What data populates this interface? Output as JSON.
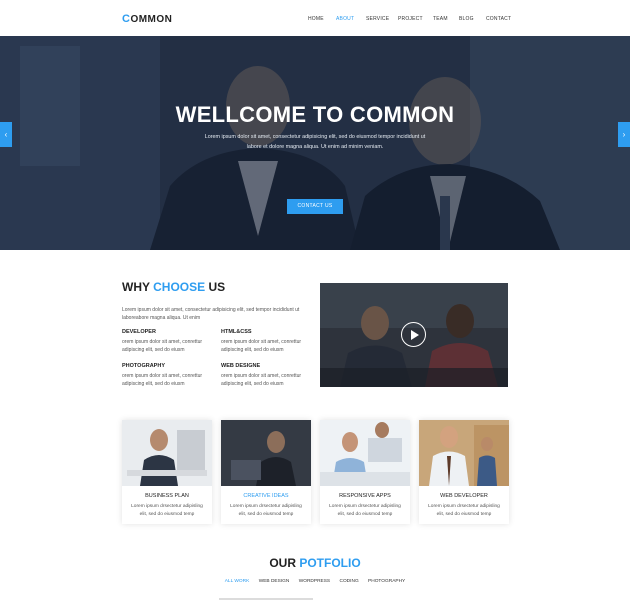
{
  "brand": {
    "first_letter": "C",
    "rest": "OMMON"
  },
  "nav": {
    "items": [
      {
        "label": "HOME"
      },
      {
        "label": "ABOUT",
        "active": true
      },
      {
        "label": "SERVICE"
      },
      {
        "label": "PROJECT"
      },
      {
        "label": "TEAM"
      },
      {
        "label": "BLOG"
      },
      {
        "label": "CONTACT"
      }
    ]
  },
  "hero": {
    "title": "WELLCOME TO COMMON",
    "text_line1": "Lorem ipsum dolor sit amet, consectetur adipisicing elit, sed do eiusmod tempor incididunt ut",
    "text_line2": "labore et dolore magna aliqua. Ut enim ad minim veniam.",
    "button": "CONTACT US",
    "prev_icon": "chevron-left-icon",
    "next_icon": "chevron-right-icon",
    "prev_glyph": "‹",
    "next_glyph": "›"
  },
  "why": {
    "title_part1": "WHY ",
    "title_part2": "CHOOSE",
    "title_part3": " US",
    "intro": "Lorem ipsum dolor sit amet, consectetur adipisicing elit, sed tempor incididunt ut laboreabore magna aliqua. Ut enim",
    "features": [
      {
        "title": "DEVELOPER",
        "text": "orem ipsum dolor sit amet, conrettur adipiscing elit, sed do eiusm"
      },
      {
        "title": "HTML&CSS",
        "text": "orem ipsum dolor sit amet, conrettur adipiscing elit, sed do eiusm"
      },
      {
        "title": "PHOTOGRAPHY",
        "text": "orem ipsum dolor sit amet, conrettur adipiscing elit, sed do eiusm"
      },
      {
        "title": "WEB DESIGNE",
        "text": "orem ipsum dolor sit amet, conrettur adipiscing elit, sed do eiusm"
      }
    ],
    "video_icon": "play-icon"
  },
  "services": [
    {
      "title": "BUSINESS PLAN",
      "text": "Lorem ipsum drsectetur adipisling elit, sed do eiusmod temp"
    },
    {
      "title": "CREATIVE IDEAS",
      "text": "Lorem ipsum drsectetur adipisling elit, sed do eiusmod temp",
      "active": true
    },
    {
      "title": "RESPONSIVE APPS",
      "text": "Lorem ipsum drsectetur adipisling elit, sed do eiusmod temp"
    },
    {
      "title": "WEB DEVELOPER",
      "text": "Lorem ipsum drsectetur adipisling elit, sed do eiusmod temp"
    }
  ],
  "portfolio": {
    "title_part1": "OUR ",
    "title_part2": "POTFOLIO",
    "filters": [
      {
        "label": "ALL WORK",
        "active": true
      },
      {
        "label": "WEB DESIGN"
      },
      {
        "label": "WORDPRESS"
      },
      {
        "label": "CODING"
      },
      {
        "label": "PHOTOGRAPHY"
      }
    ]
  },
  "colors": {
    "accent": "#2e9df0",
    "text": "#222222",
    "muted": "#555555"
  }
}
